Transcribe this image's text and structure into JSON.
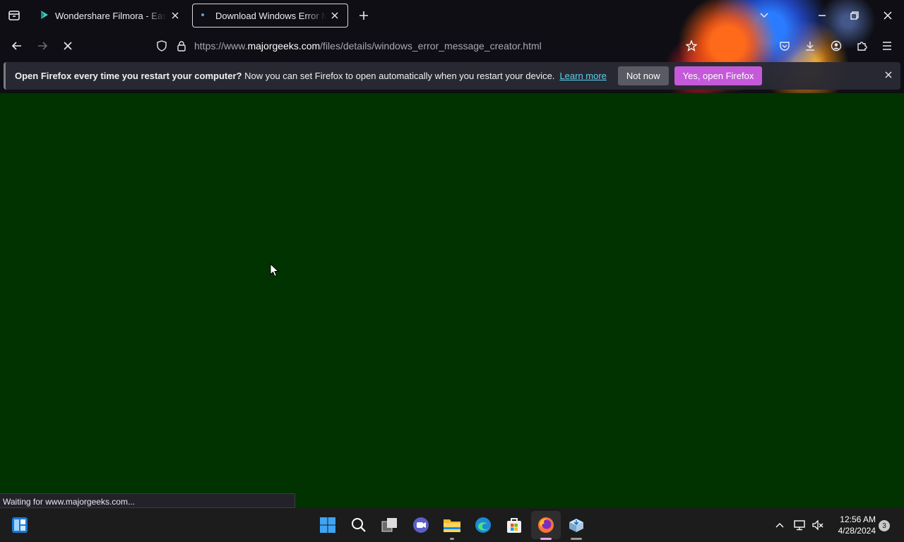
{
  "browser": {
    "tabs": [
      {
        "title": "Wondershare Filmora - Easy-to",
        "state": "inactive",
        "icon": "filmora-icon"
      },
      {
        "title": "Download Windows Error Mess",
        "state": "active",
        "icon": "loading-dot-icon"
      }
    ],
    "url": {
      "prefix": "https://www.",
      "host": "majorgeeks.com",
      "path": "/files/details/windows_error_message_creator.html"
    }
  },
  "notification": {
    "bold_text": "Open Firefox every time you restart your computer?",
    "text": " Now you can set Firefox to open automatically when you restart your device.",
    "learn_more": "Learn more",
    "not_now": "Not now",
    "yes_open": "Yes, open Firefox"
  },
  "status": {
    "text": "Waiting for www.majorgeeks.com..."
  },
  "taskbar": {
    "time": "12:56 AM",
    "date": "4/28/2024",
    "notification_count": "3"
  },
  "colors": {
    "page_background": "#013300",
    "accent_button": "#c45ad9",
    "link": "#5ad3f0",
    "chrome": "#0e0e14",
    "taskbar": "#1c1c1c"
  }
}
